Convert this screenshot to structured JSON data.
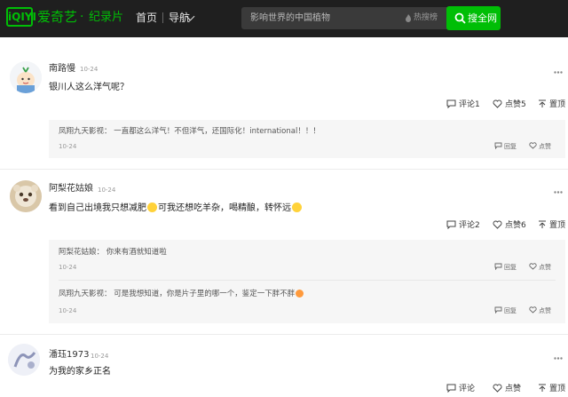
{
  "header": {
    "logo_mark": "iQIYI",
    "logo_text": "爱奇艺",
    "logo_dot": "·",
    "channel": "纪录片",
    "nav_home": "首页",
    "nav_menu": "导航",
    "search_placeholder": "影响世界的中国植物",
    "hot_label": "热搜榜",
    "search_button": "搜全网",
    "accent_color": "#00be06"
  },
  "comments": [
    {
      "user": "南路慢",
      "time": "10-24",
      "text": "银川人这么洋气呢？",
      "comment_label": "评论1",
      "like_label": "点赞5",
      "top_label": "置顶",
      "replies": [
        {
          "user": "凤翔九天影视",
          "text": "一直都这么洋气！不但洋气，还国际化！international！！！",
          "time": "10-24",
          "reply_label": "回复",
          "like_label": "点赞"
        }
      ]
    },
    {
      "user": "阿梨花姑娘",
      "time": "10-24",
      "text_before": "看到自己出境我只想减肥",
      "text_middle": "可我还想吃羊杂，喝精酿，转怀远",
      "comment_label": "评论2",
      "like_label": "点赞6",
      "top_label": "置顶",
      "replies": [
        {
          "user": "阿梨花姑娘",
          "text": "你来有酒就知道啦",
          "time": "10-24",
          "reply_label": "回复",
          "like_label": "点赞"
        },
        {
          "user": "凤翔九天影视",
          "text": "可是我想知道，你是片子里的哪一个，鉴定一下胖不胖",
          "time": "10-24",
          "reply_label": "回复",
          "like_label": "点赞"
        }
      ]
    },
    {
      "user": "潘珏1973",
      "time": "10-24",
      "text": "为我的家乡正名",
      "comment_label": "评论",
      "like_label": "点赞",
      "top_label": "置顶"
    }
  ],
  "icons": [
    "search-icon",
    "chevron-down-icon",
    "comment-icon",
    "heart-icon",
    "top-icon",
    "more-icon",
    "reply-icon"
  ]
}
